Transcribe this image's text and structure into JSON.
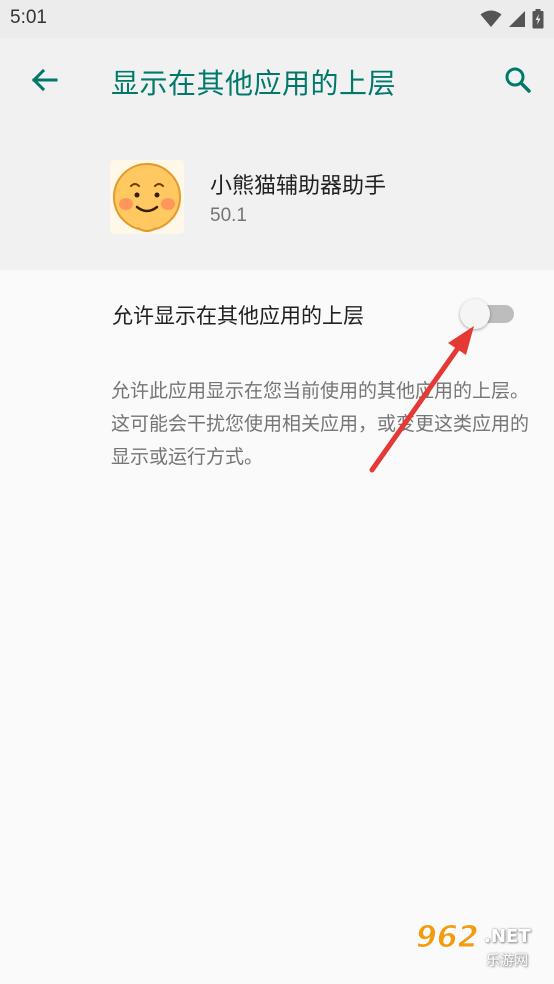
{
  "status_bar": {
    "time": "5:01"
  },
  "header": {
    "title": "显示在其他应用的上层"
  },
  "app": {
    "name": "小熊猫辅助器助手",
    "version": "50.1"
  },
  "setting": {
    "label": "允许显示在其他应用的上层",
    "enabled": false,
    "description": "允许此应用显示在您当前使用的其他应用的上层。这可能会干扰您使用相关应用，或变更这类应用的显示或运行方式。"
  },
  "watermark": {
    "number": "962",
    "domain": ".NET",
    "sub": "乐游网"
  },
  "colors": {
    "accent": "#00796b",
    "arrow": "#e53935",
    "toggle_track": "#bdbdbd"
  },
  "icons": [
    "wifi-icon",
    "signal-icon",
    "battery-icon",
    "back-arrow-icon",
    "search-icon",
    "app-emoji-icon"
  ]
}
